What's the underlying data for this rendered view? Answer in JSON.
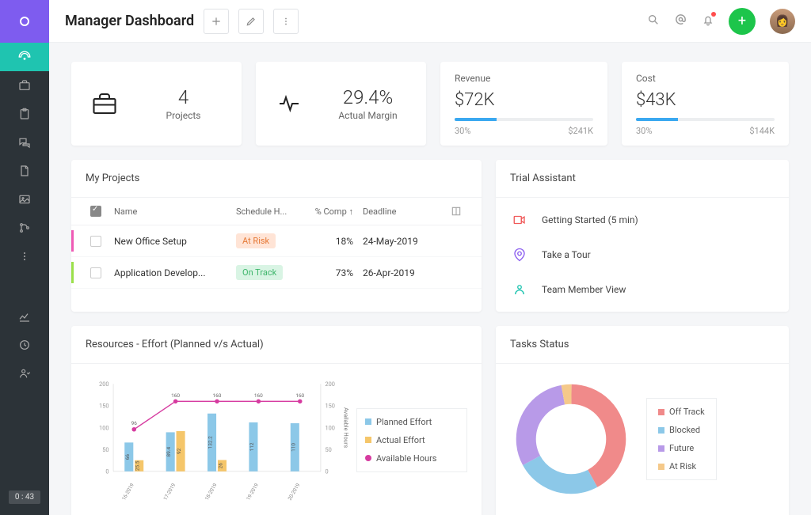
{
  "header": {
    "title": "Manager Dashboard",
    "timer": "0 : 43"
  },
  "sidebar": {
    "items": [
      "dashboard",
      "briefcase",
      "clipboard",
      "chat",
      "file",
      "image",
      "git",
      "more",
      "chart",
      "clock",
      "user"
    ]
  },
  "stats": {
    "projects": {
      "value": "4",
      "label": "Projects"
    },
    "margin": {
      "value": "29.4%",
      "label": "Actual Margin"
    },
    "revenue": {
      "title": "Revenue",
      "value": "$72K",
      "percent": "30%",
      "total": "$241K",
      "fill": 30
    },
    "cost": {
      "title": "Cost",
      "value": "$43K",
      "percent": "30%",
      "total": "$144K",
      "fill": 30
    }
  },
  "projects": {
    "title": "My Projects",
    "cols": {
      "name": "Name",
      "sched": "Schedule H...",
      "comp": "% Comp",
      "dead": "Deadline"
    },
    "rows": [
      {
        "name": "New Office Setup",
        "status": "At Risk",
        "statusCls": "b-risk",
        "comp": "18%",
        "deadline": "24-May-2019",
        "stripe": "#ef5ab5"
      },
      {
        "name": "Application Develop...",
        "status": "On Track",
        "statusCls": "b-track",
        "comp": "73%",
        "deadline": "26-Apr-2019",
        "stripe": "#9be04a"
      }
    ]
  },
  "assistant": {
    "title": "Trial Assistant",
    "items": [
      {
        "label": "Getting Started (5 min)",
        "color": "#f05a5a",
        "icon": "video"
      },
      {
        "label": "Take a Tour",
        "color": "#8a5cef",
        "icon": "pin"
      },
      {
        "label": "Team Member View",
        "color": "#1fc4b0",
        "icon": "user"
      }
    ]
  },
  "resources": {
    "title": "Resources - Effort (Planned v/s Actual)",
    "legend": {
      "planned": "Planned Effort",
      "actual": "Actual Effort",
      "avail": "Available Hours"
    },
    "ylabel": "Available Hours"
  },
  "tasks": {
    "title": "Tasks Status",
    "legend": [
      "Off Track",
      "Blocked",
      "Future",
      "At Risk"
    ],
    "colors": [
      "#f08a8a",
      "#8cc8e8",
      "#b89ae8",
      "#f5c98a"
    ]
  },
  "chart_data": [
    {
      "type": "bar",
      "title": "Resources - Effort (Planned v/s Actual)",
      "categories": [
        "16-2019",
        "17-2019",
        "18-2019",
        "19-2019",
        "20-2019"
      ],
      "series": [
        {
          "name": "Planned Effort",
          "values": [
            66,
            89.4,
            132.2,
            112,
            110
          ]
        },
        {
          "name": "Actual Effort",
          "values": [
            25.5,
            92,
            26,
            null,
            null
          ]
        },
        {
          "name": "Available Hours",
          "values": [
            96,
            160,
            160,
            160,
            160
          ]
        }
      ],
      "ylim": [
        0,
        200
      ],
      "y2lim": [
        0,
        200
      ],
      "y2label": "Available Hours",
      "yticks": [
        0,
        50,
        100,
        150,
        200
      ],
      "y2ticks": [
        0,
        50,
        100,
        150,
        200
      ]
    },
    {
      "type": "pie",
      "title": "Tasks Status",
      "categories": [
        "Off Track",
        "Blocked",
        "Future",
        "At Risk"
      ],
      "values": [
        42,
        25,
        30,
        3
      ]
    }
  ]
}
